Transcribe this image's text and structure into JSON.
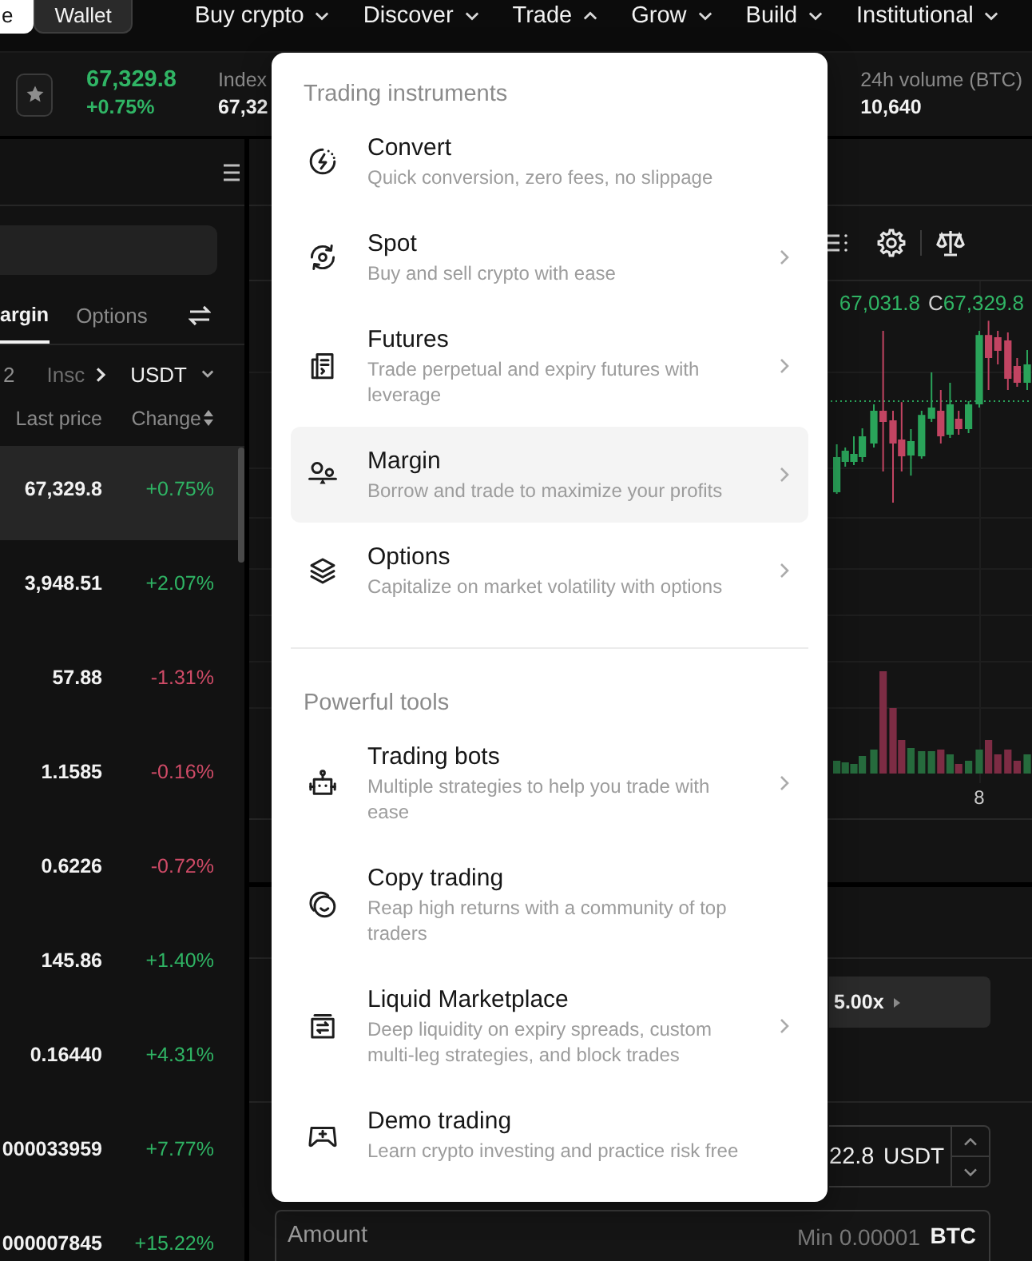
{
  "top_nav": {
    "toggle": [
      {
        "label": "e",
        "selected": true
      },
      {
        "label": "Wallet",
        "selected": false
      }
    ],
    "items": [
      {
        "label": "Buy crypto",
        "expanded": false
      },
      {
        "label": "Discover",
        "expanded": false
      },
      {
        "label": "Trade",
        "expanded": true
      },
      {
        "label": "Grow",
        "expanded": false
      },
      {
        "label": "Build",
        "expanded": false
      },
      {
        "label": "Institutional",
        "expanded": false
      }
    ]
  },
  "ticker": {
    "last_price": "67,329.8",
    "change": "+0.75%",
    "index_label": "Index",
    "index_value": "67,32",
    "volume_label": "24h volume (BTC)",
    "volume_value": "10,640"
  },
  "market_list": {
    "tabs": [
      {
        "label": "argin",
        "selected": true
      },
      {
        "label": "Options",
        "selected": false
      }
    ],
    "filter_tabs": [
      "2",
      "Insc"
    ],
    "quote_currency": "USDT",
    "columns": [
      "Last price",
      "Change"
    ],
    "rows": [
      {
        "price": "67,329.8",
        "change": "+0.75%",
        "color": "#2fb464",
        "selected": true
      },
      {
        "price": "3,948.51",
        "change": "+2.07%",
        "color": "#2fb464",
        "selected": false
      },
      {
        "price": "57.88",
        "change": "-1.31%",
        "color": "#cf4b67",
        "selected": false
      },
      {
        "price": "1.1585",
        "change": "-0.16%",
        "color": "#cf4b67",
        "selected": false
      },
      {
        "price": "0.6226",
        "change": "-0.72%",
        "color": "#cf4b67",
        "selected": false
      },
      {
        "price": "145.86",
        "change": "+1.40%",
        "color": "#2fb464",
        "selected": false
      },
      {
        "price": "0.16440",
        "change": "+4.31%",
        "color": "#2fb464",
        "selected": false
      },
      {
        "price": "000033959",
        "change": "+7.77%",
        "color": "#2fb464",
        "selected": false
      },
      {
        "price": "000007845",
        "change": "+15.22%",
        "color": "#2fb464",
        "selected": false
      }
    ]
  },
  "chart": {
    "low": "67,031.8",
    "close_label": "C",
    "close": "67,329.8",
    "x_label": "8"
  },
  "order_form": {
    "leverage": "5.00x",
    "price_value": "22.8",
    "price_unit": "USDT",
    "amount_label": "Amount",
    "amount_placeholder": "Min 0.00001",
    "amount_unit": "BTC"
  },
  "menu": {
    "sections": [
      {
        "title": "Trading instruments",
        "items": [
          {
            "title": "Convert",
            "description": "Quick conversion, zero fees, no slippage",
            "chevron": false,
            "highlighted": false
          },
          {
            "title": "Spot",
            "description": "Buy and sell crypto with ease",
            "chevron": true,
            "highlighted": false
          },
          {
            "title": "Futures",
            "description": "Trade perpetual and expiry futures with leverage",
            "chevron": true,
            "highlighted": false
          },
          {
            "title": "Margin",
            "description": "Borrow and trade to maximize your profits",
            "chevron": true,
            "highlighted": true
          },
          {
            "title": "Options",
            "description": "Capitalize on market volatility with options",
            "chevron": true,
            "highlighted": false
          }
        ]
      },
      {
        "title": "Powerful tools",
        "items": [
          {
            "title": "Trading bots",
            "description": "Multiple strategies to help you trade with ease",
            "chevron": true,
            "highlighted": false
          },
          {
            "title": "Copy trading",
            "description": "Reap high returns with a community of top traders",
            "chevron": false,
            "highlighted": false
          },
          {
            "title": "Liquid Marketplace",
            "description": "Deep liquidity on expiry spreads, custom multi-leg strategies, and block trades",
            "chevron": true,
            "highlighted": false
          },
          {
            "title": "Demo trading",
            "description": "Learn crypto investing and practice risk free",
            "chevron": false,
            "highlighted": false
          }
        ]
      }
    ]
  }
}
